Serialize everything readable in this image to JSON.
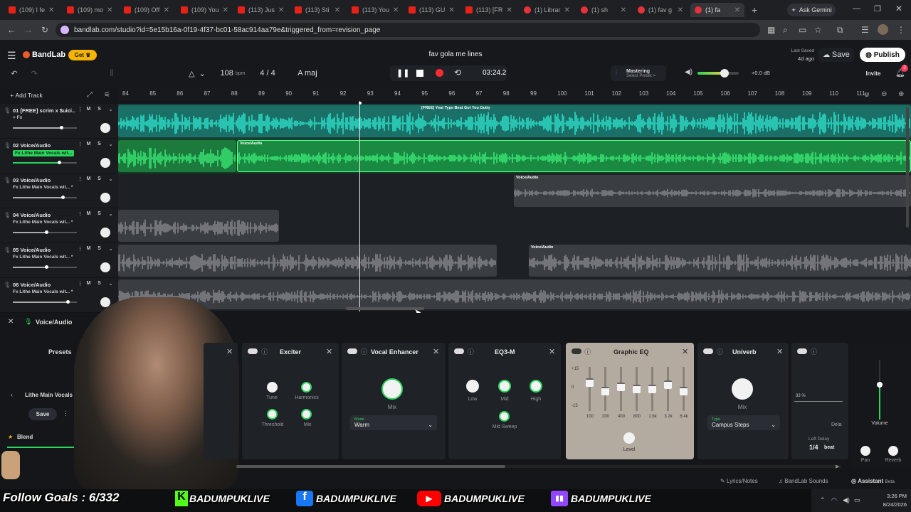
{
  "browser": {
    "tabs": [
      {
        "title": "(109) I fe",
        "active": false
      },
      {
        "title": "(109) mo",
        "active": false
      },
      {
        "title": "(109) Off",
        "active": false
      },
      {
        "title": "(109) You",
        "active": false
      },
      {
        "title": "(113) Jus",
        "active": false
      },
      {
        "title": "(113) Sti",
        "active": false
      },
      {
        "title": "(113) You",
        "active": false
      },
      {
        "title": "(113) GU",
        "active": false
      },
      {
        "title": "(113) [FR",
        "active": false
      },
      {
        "title": "(1) Librar",
        "active": false
      },
      {
        "title": "(1) sh",
        "active": false
      },
      {
        "title": "(1) fav g",
        "active": false
      },
      {
        "title": "(1) fa",
        "active": true
      }
    ],
    "new_tab": "+",
    "ask_gemini": "Ask Gemini",
    "url": "bandlab.com/studio?id=5e15b16a-0f19-4f37-bc01-58ac914aa79e&triggered_from=revision_page"
  },
  "app": {
    "brand": "BandLab",
    "get_label": "Get",
    "project_title": "fav gola me lines",
    "last_saved_label": "Last Saved",
    "last_saved_value": "4d ago",
    "save_label": "Save",
    "publish_label": "Publish",
    "invite_label": "Invite",
    "notif_count": "2",
    "tempo_value": "108",
    "tempo_unit": "bpm",
    "time_sig": "4 / 4",
    "key": "A maj",
    "time": "03:24.2",
    "mastering_label": "Mastering",
    "mastering_preset": "Select Preset >",
    "master_db": "+0.0 dB",
    "add_track": "Add Track"
  },
  "ruler": [
    "84",
    "85",
    "86",
    "87",
    "88",
    "89",
    "90",
    "91",
    "92",
    "93",
    "94",
    "95",
    "96",
    "97",
    "98",
    "99",
    "100",
    "101",
    "102",
    "103",
    "104",
    "105",
    "106",
    "107",
    "108",
    "109",
    "110",
    "111"
  ],
  "tracks": [
    {
      "num": "01",
      "name": "[FREE] scrim x $uici...",
      "fx": "+ Fx",
      "fx_active": false,
      "vol": 0.75
    },
    {
      "num": "02",
      "name": "Voice/Audio",
      "fx": "Fx Lithe Main Vocals wit...",
      "fx_active": true,
      "vol": 0.72
    },
    {
      "num": "03",
      "name": "Voice/Audio",
      "fx": "Fx Lithe Main Vocals wit... *",
      "fx_active": false,
      "vol": 0.78
    },
    {
      "num": "04",
      "name": "Voice/Audio",
      "fx": "Fx Lithe Main Vocals wit... *",
      "fx_active": false,
      "vol": 0.52
    },
    {
      "num": "05",
      "name": "Voice/Audio",
      "fx": "Fx Lithe Main Vocals wit... *",
      "fx_active": false,
      "vol": 0.52
    },
    {
      "num": "06",
      "name": "Voice/Audio",
      "fx": "Fx Lithe Main Vocals wit... *",
      "fx_active": false,
      "vol": 0.85
    }
  ],
  "clips": {
    "c1_label": "[FREE] Yeat Type Beat Got You Gutty",
    "c2_label": "Voice/Audio",
    "c3_label": "Voice/Audio",
    "c5_label": "Voice/Audio"
  },
  "panel": {
    "track_label": "Voice/Audio",
    "presets_label": "Presets",
    "preset_name": "Lithe Main Vocals",
    "save_label": "Save",
    "blend_label": "Blend"
  },
  "devices": {
    "exciter": {
      "title": "Exciter",
      "k1": "Tune",
      "k2": "Harmonics",
      "k3": "Threshold",
      "k4": "Mix"
    },
    "vocal_enhancer": {
      "title": "Vocal Enhancer",
      "mix": "Mix",
      "mode_cap": "Mode",
      "mode": "Warm"
    },
    "eq3m": {
      "title": "EQ3-M",
      "low": "Low",
      "mid": "Mid",
      "high": "High",
      "sweep": "Mid Sweep"
    },
    "graphic_eq": {
      "title": "Graphic EQ",
      "db": [
        "+15",
        "0",
        "-15"
      ],
      "bands": [
        "100",
        "200",
        "400",
        "800",
        "1.6k",
        "3.2k",
        "6.4k"
      ],
      "level": "Level"
    },
    "univerb": {
      "title": "Univerb",
      "mix": "Mix",
      "type_cap": "Type",
      "type": "Campus Steps"
    },
    "delay": {
      "pct": "33 %",
      "dela": "Dela",
      "left_delay": "Left Delay",
      "beat": "1/4",
      "beat_unit": "beat"
    },
    "master": {
      "volume": "Volume",
      "pan": "Pan",
      "reverb": "Reverb"
    }
  },
  "bottom": {
    "lyrics": "Lyrics/Notes",
    "sounds": "BandLab Sounds",
    "assistant": "Assistant",
    "beta": "Beta"
  },
  "overlay": {
    "follow_goals": "Follow Goals : 6/332",
    "handle1": "BADUMPUKLIVE",
    "handle2": "BADUMPUKLIVE",
    "handle3": "BADUMPUKLIVE",
    "handle4": "BADUMPUKLIVE"
  },
  "taskbar": {
    "time": "3:26 PM",
    "date": "8/24/2026"
  },
  "colors": {
    "accent": "#2bd45c",
    "track1": "#1fc9b0",
    "track2": "#23c456",
    "brand": "#f05a28",
    "record": "#ff2d2d"
  }
}
